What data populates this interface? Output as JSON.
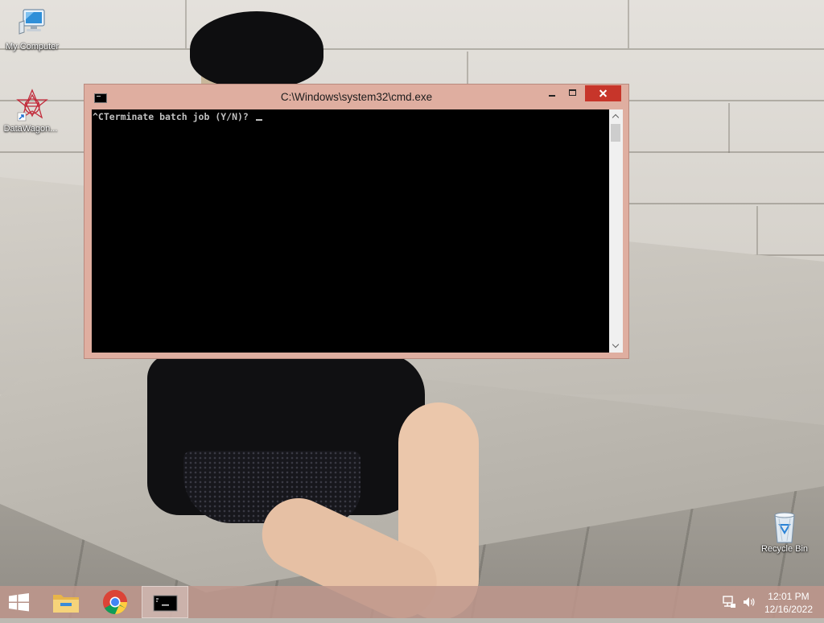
{
  "desktop": {
    "icons": [
      {
        "label": "My Computer",
        "icon": "computer-icon"
      },
      {
        "label": "DataWagon...",
        "icon": "datawagon-icon"
      },
      {
        "label": "Recycle Bin",
        "icon": "recycle-bin-icon"
      }
    ]
  },
  "window": {
    "title": "C:\\Windows\\system32\\cmd.exe",
    "console_output": "^CTerminate batch job (Y/N)? "
  },
  "taskbar": {
    "apps": [
      {
        "name": "File Explorer",
        "icon": "folder-icon"
      },
      {
        "name": "Google Chrome",
        "icon": "chrome-icon"
      },
      {
        "name": "Command Prompt",
        "icon": "cmd-icon",
        "active": true
      }
    ],
    "tray": {
      "icons": [
        "network-icon",
        "speaker-icon"
      ]
    },
    "clock": {
      "time": "12:01 PM",
      "date": "12/16/2022"
    }
  },
  "colors": {
    "window_frame": "#dfaea0",
    "close_button": "#c7352a",
    "taskbar": "#be968c",
    "console_bg": "#000000",
    "console_text": "#c0c0c0"
  }
}
